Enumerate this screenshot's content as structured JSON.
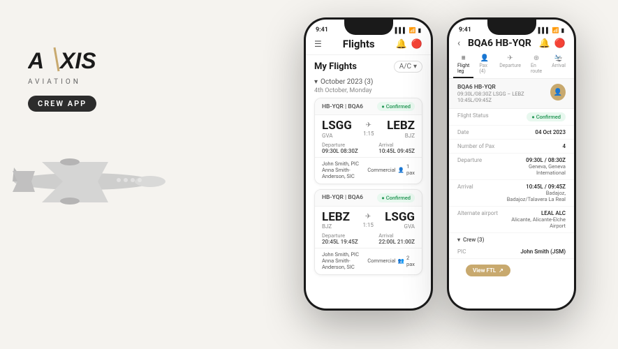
{
  "branding": {
    "logo_text": "AXIS",
    "logo_sub": "AVIATION",
    "crew_badge": "CREW APP"
  },
  "phone1": {
    "status_time": "9:41",
    "header_title": "Flights",
    "section_label": "My Flights",
    "ac_selector": "A/C",
    "month_group": "October 2023 (3)",
    "date_sub": "4th October, Monday",
    "cards": [
      {
        "id": "HB-YQR | BQA6",
        "status": "Confirmed",
        "from_code": "LSGG",
        "from_sub": "GVA",
        "to_code": "LEBZ",
        "to_sub": "BJZ",
        "duration": "1:15",
        "dep_label": "Departure",
        "dep_time": "09:30L 08:30Z",
        "arr_label": "Arrival",
        "arr_time": "10:45L 09:45Z",
        "crew": "John Smith, PIC",
        "crew2": "Anna Smith-Anderson, SIC",
        "pax_type": "Commercial",
        "pax_count": "1 pax"
      },
      {
        "id": "HB-YQR | BQA6",
        "status": "Confirmed",
        "from_code": "LEBZ",
        "from_sub": "BJZ",
        "to_code": "LSGG",
        "to_sub": "GVA",
        "duration": "1:15",
        "dep_label": "Departure",
        "dep_time": "20:45L 19:45Z",
        "arr_label": "Arrival",
        "arr_time": "22:00L 21:00Z",
        "crew": "John Smith, PIC",
        "crew2": "Anna Smith-Anderson, SIC",
        "pax_type": "Commercial",
        "pax_count": "2 pax"
      }
    ]
  },
  "phone2": {
    "status_time": "9:41",
    "header_title": "BQA6 HB-YQR",
    "tabs": [
      {
        "label": "Flight leg",
        "icon": "≡",
        "active": true
      },
      {
        "label": "Pax (4)",
        "icon": "👤",
        "active": false
      },
      {
        "label": "Departure",
        "icon": "✈",
        "active": false
      },
      {
        "label": "En route",
        "icon": "⊕",
        "active": false
      },
      {
        "label": "Arrival",
        "icon": "🛬",
        "active": false
      }
    ],
    "flight_summary_id": "BQA6 HB-YQR",
    "flight_summary_route": "09:30L/08:30Z LSGG – LEBZ 10:45L/09:45Z",
    "flight_status_label": "Flight Status",
    "flight_status_value": "Confirmed",
    "date_label": "Date",
    "date_value": "04 Oct 2023",
    "pax_label": "Number of Pax",
    "pax_value": "4",
    "dep_label": "Departure",
    "dep_value": "09:30L / 08:30Z",
    "dep_airport": "Geneva, Geneva International",
    "arr_label": "Arrival",
    "arr_value": "10:45L / 09:45Z",
    "arr_airport": "Badajoz, Badajoz/Talavera La Real",
    "alt_label": "Alternate airport",
    "alt_value": "LEAL ALC",
    "alt_airport": "Alicante, Alicante-Elche Airport",
    "crew_section": "Crew (3)",
    "pic_label": "PIC",
    "pic_value": "John Smith (JSM)",
    "ftl_button": "View FTL"
  }
}
